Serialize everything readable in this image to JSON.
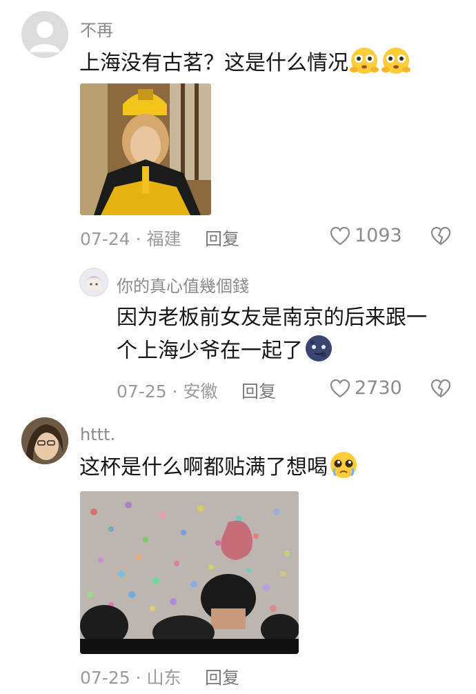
{
  "comments": [
    {
      "username": "不再",
      "text": "上海没有古茗？这是什么情况",
      "date": "07-24",
      "location": "福建",
      "reply_label": "回复",
      "likes": "1093",
      "emoji": [
        "flushed-face-emoji",
        "flushed-face-emoji"
      ],
      "image": "monkey-king-costume-meme"
    },
    {
      "username": "你的真心值幾個錢",
      "text_line1": "因为老板前女友是南京的后来跟一",
      "text_line2": "个上海少爷在一起了",
      "date": "07-25",
      "location": "安徽",
      "reply_label": "回复",
      "likes": "2730",
      "emoji": [
        "dark-moon-face-emoji"
      ]
    },
    {
      "username": "httt.",
      "text": "这杯是什么啊都贴满了想喝",
      "date": "07-25",
      "location": "山东",
      "reply_label": "回复",
      "emoji": [
        "pleading-teary-face-emoji"
      ],
      "image": "confetti-crowd-photo"
    }
  ],
  "colors": {
    "text": "#161616",
    "meta": "#9a9a9a",
    "background": "#ffffff"
  }
}
